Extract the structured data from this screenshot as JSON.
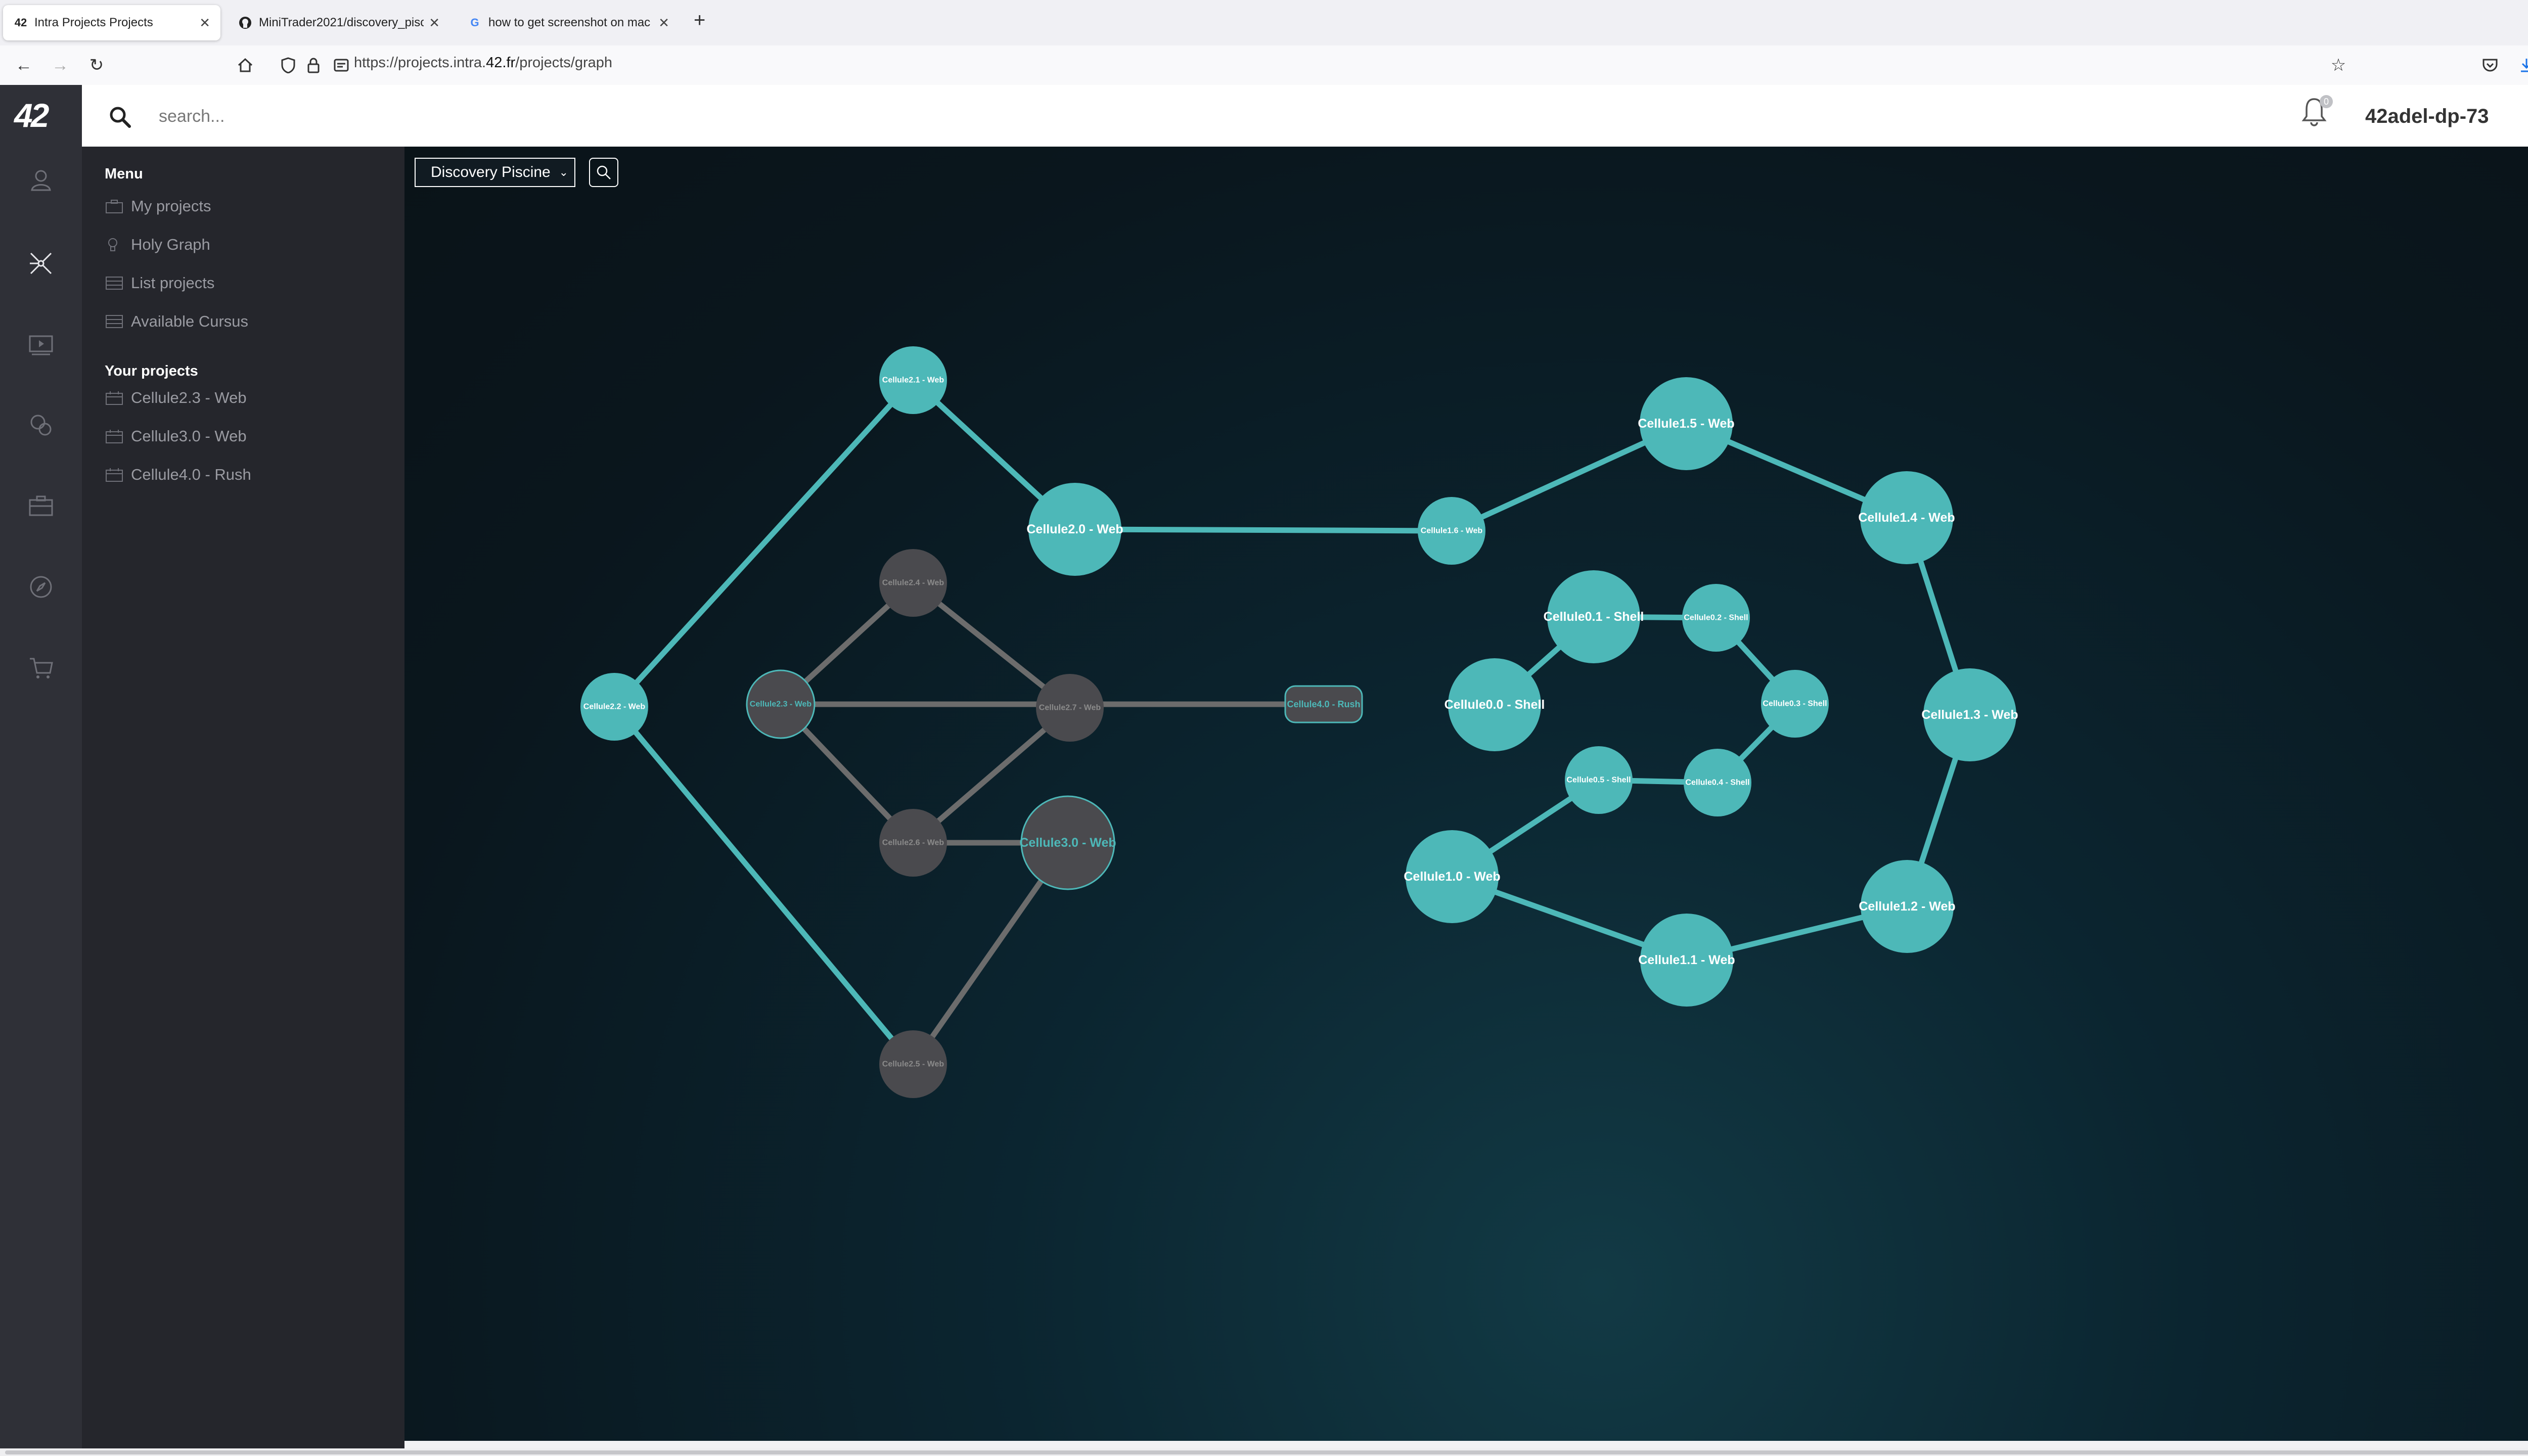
{
  "browser": {
    "tabs": [
      {
        "title": "Intra Projects Projects",
        "favicon": "42",
        "active": true
      },
      {
        "title": "MiniTrader2021/discovery_pisci",
        "favicon": "github-icon",
        "active": false
      },
      {
        "title": "how to get screenshot on mac",
        "favicon": "G",
        "active": false
      }
    ],
    "url_prefix": "https://projects.intra.",
    "url_domain": "42.fr",
    "url_path": "/projects/graph"
  },
  "app": {
    "logo": "42",
    "search_placeholder": "search...",
    "notification_count": "0",
    "username": "42adel-dp-73"
  },
  "menu": {
    "heading": "Menu",
    "items": [
      {
        "label": "My projects",
        "icon": "briefcase-icon"
      },
      {
        "label": "Holy Graph",
        "icon": "lightbulb-icon"
      },
      {
        "label": "List projects",
        "icon": "list-icon"
      },
      {
        "label": "Available Cursus",
        "icon": "list-icon"
      }
    ],
    "your_projects_heading": "Your projects",
    "your_projects": [
      {
        "label": "Cellule2.3 - Web",
        "icon": "calendar-icon"
      },
      {
        "label": "Cellule3.0 - Web",
        "icon": "calendar-icon"
      },
      {
        "label": "Cellule4.0 - Rush",
        "icon": "calendar-icon"
      }
    ]
  },
  "graph": {
    "cursus_selected": "Discovery Piscine",
    "colors": {
      "validated": "#4db8b8",
      "available": "#4a4a4e",
      "edge_validated": "#4db8b8",
      "edge_available": "#6c6c6c",
      "label_validated": "#ffffff",
      "label_available": "#8a8a8a",
      "label_inprogress": "#4db8b8"
    },
    "nodes": [
      {
        "id": "c21",
        "label": "Cellule2.1 - Web",
        "state": "validated",
        "size": "small"
      },
      {
        "id": "c20",
        "label": "Cellule2.0 - Web",
        "state": "validated",
        "size": "large"
      },
      {
        "id": "c22",
        "label": "Cellule2.2 - Web",
        "state": "validated",
        "size": "small"
      },
      {
        "id": "c25",
        "label": "Cellule2.5 - Web",
        "state": "available",
        "size": "small"
      },
      {
        "id": "c24",
        "label": "Cellule2.4 - Web",
        "state": "available",
        "size": "small"
      },
      {
        "id": "c23",
        "label": "Cellule2.3 - Web",
        "state": "in_progress",
        "size": "small"
      },
      {
        "id": "c27",
        "label": "Cellule2.7 - Web",
        "state": "available",
        "size": "small"
      },
      {
        "id": "c30",
        "label": "Cellule3.0 - Web",
        "state": "in_progress",
        "size": "large"
      },
      {
        "id": "c26",
        "label": "Cellule2.6 - Web",
        "state": "available",
        "size": "small"
      },
      {
        "id": "c40",
        "label": "Cellule4.0 - Rush",
        "state": "in_progress",
        "size": "rush"
      },
      {
        "id": "c16",
        "label": "Cellule1.6 - Web",
        "state": "validated",
        "size": "small"
      },
      {
        "id": "c15",
        "label": "Cellule1.5 - Web",
        "state": "validated",
        "size": "large"
      },
      {
        "id": "c14",
        "label": "Cellule1.4 - Web",
        "state": "validated",
        "size": "large"
      },
      {
        "id": "c13",
        "label": "Cellule1.3 - Web",
        "state": "validated",
        "size": "large"
      },
      {
        "id": "c12",
        "label": "Cellule1.2 - Web",
        "state": "validated",
        "size": "large"
      },
      {
        "id": "c11",
        "label": "Cellule1.1 - Web",
        "state": "validated",
        "size": "large"
      },
      {
        "id": "c10",
        "label": "Cellule1.0 - Web",
        "state": "validated",
        "size": "large"
      },
      {
        "id": "s01",
        "label": "Cellule0.1 - Shell",
        "state": "validated",
        "size": "large"
      },
      {
        "id": "s00",
        "label": "Cellule0.0 - Shell",
        "state": "validated",
        "size": "large"
      },
      {
        "id": "s02",
        "label": "Cellule0.2 - Shell",
        "state": "validated",
        "size": "small"
      },
      {
        "id": "s03",
        "label": "Cellule0.3 - Shell",
        "state": "validated",
        "size": "small"
      },
      {
        "id": "s04",
        "label": "Cellule0.4 - Shell",
        "state": "validated",
        "size": "small"
      },
      {
        "id": "s05",
        "label": "Cellule0.5 - Shell",
        "state": "validated",
        "size": "small"
      }
    ],
    "edges": [
      [
        "c21",
        "c20",
        "validated"
      ],
      [
        "c21",
        "c22",
        "validated"
      ],
      [
        "c22",
        "c25",
        "validated"
      ],
      [
        "c20",
        "c16",
        "validated"
      ],
      [
        "c24",
        "c23",
        "available"
      ],
      [
        "c24",
        "c27",
        "available"
      ],
      [
        "c23",
        "c26",
        "available"
      ],
      [
        "c27",
        "c26",
        "available"
      ],
      [
        "c26",
        "c30",
        "available"
      ],
      [
        "c30",
        "c25",
        "available"
      ],
      [
        "c23",
        "c40",
        "available"
      ],
      [
        "c16",
        "c15",
        "validated"
      ],
      [
        "c15",
        "c14",
        "validated"
      ],
      [
        "c14",
        "c13",
        "validated"
      ],
      [
        "c13",
        "c12",
        "validated"
      ],
      [
        "c12",
        "c11",
        "validated"
      ],
      [
        "c11",
        "c10",
        "validated"
      ],
      [
        "c10",
        "s05",
        "validated"
      ],
      [
        "s05",
        "s04",
        "validated"
      ],
      [
        "s04",
        "s03",
        "validated"
      ],
      [
        "s03",
        "s02",
        "validated"
      ],
      [
        "s02",
        "s01",
        "validated"
      ],
      [
        "s01",
        "s00",
        "validated"
      ]
    ]
  }
}
